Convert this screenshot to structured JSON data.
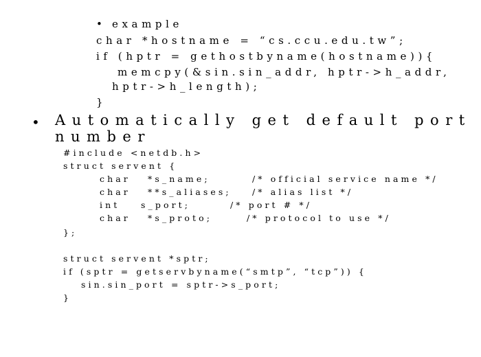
{
  "slide": {
    "example": {
      "bullet": "•",
      "title": "example",
      "lines": [
        "char *hostname = “cs.ccu.edu.tw”;",
        "if (hptr = gethostbyname(hostname)){",
        "memcpy(&sin.sin_addr, hptr->h_addr,",
        "hptr->h_length);",
        "}"
      ]
    },
    "main_bullet": {
      "bullet": "•",
      "heading_line1": "Automatically get default port",
      "heading_line2": "number"
    },
    "code": {
      "include": "#include <netdb.h>",
      "struct_open": "struct servent {",
      "fields": [
        {
          "type": "char",
          "name": "*s_name;",
          "comment": "/* official service name */"
        },
        {
          "type": "char",
          "name": "**s_aliases;",
          "comment": "/* alias list */"
        },
        {
          "type": "int",
          "name": "s_port;",
          "comment": "/* port # */"
        },
        {
          "type": "char",
          "name": "*s_proto;",
          "comment": "/* protocol to use */"
        }
      ],
      "struct_close": "};",
      "decl": "struct servent *sptr;",
      "if_line": "if (sptr = getservbyname(“smtp”, “tcp”)) {",
      "body_line": "sin.sin_port = sptr->s_port;",
      "close": "}"
    }
  }
}
